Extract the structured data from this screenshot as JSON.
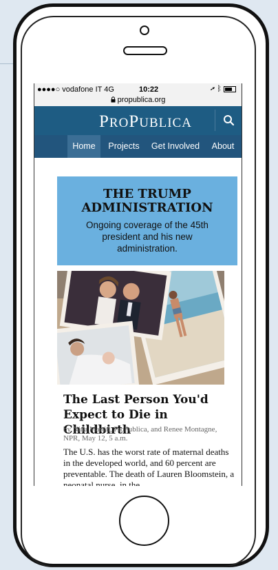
{
  "status_bar": {
    "carrier": "●●●●○ vodafone IT  4G",
    "time": "10:22",
    "url": "propublica.org"
  },
  "header": {
    "logo_first_letter": "P",
    "logo_first_rest": "RO",
    "logo_second_letter": "P",
    "logo_second_rest": "UBLICA"
  },
  "nav": {
    "items": [
      {
        "label": "Home"
      },
      {
        "label": "Projects"
      },
      {
        "label": "Get Involved"
      },
      {
        "label": "About"
      }
    ]
  },
  "banner": {
    "title": "THE TRUMP ADMINISTRATION",
    "subtitle": "Ongoing coverage of the 45th president and his new administration."
  },
  "article": {
    "headline": "The Last Person You'd Expect to Die in Childbirth",
    "byline": "by Nina Martin, ProPublica, and Renee Montagne, NPR, May 12, 5 a.m.",
    "excerpt": "The U.S. has the worst rate of maternal deaths in the developed world, and 60 percent are preventable. The death of Lauren Bloomstein, a neonatal nurse, in the"
  },
  "colors": {
    "header_bg": "#1e5c83",
    "nav_bg": "#22557d",
    "nav_active": "#3b6e95",
    "banner_bg": "#6ab0df"
  }
}
